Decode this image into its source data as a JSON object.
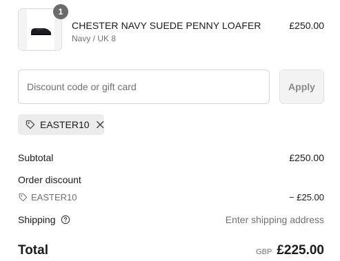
{
  "product": {
    "quantity": "1",
    "name": "CHESTER NAVY SUEDE PENNY LOAFER",
    "variant": "Navy / UK 8",
    "price": "£250.00",
    "thumbnail_icon": "loafer-shoe-icon"
  },
  "discount": {
    "placeholder": "Discount code or gift card",
    "value": "",
    "apply_label": "Apply"
  },
  "applied_code": {
    "code": "EASTER10",
    "tag_icon": "tag-icon",
    "remove_icon": "close-icon"
  },
  "summary": {
    "subtotal_label": "Subtotal",
    "subtotal_value": "£250.00",
    "order_discount_label": "Order discount",
    "order_discount_code": "EASTER10",
    "order_discount_value": "− £25.00",
    "shipping_label": "Shipping",
    "shipping_help_icon": "help-circle-icon",
    "shipping_value": "Enter shipping address",
    "total_label": "Total",
    "total_currency": "GBP",
    "total_value": "£225.00"
  }
}
